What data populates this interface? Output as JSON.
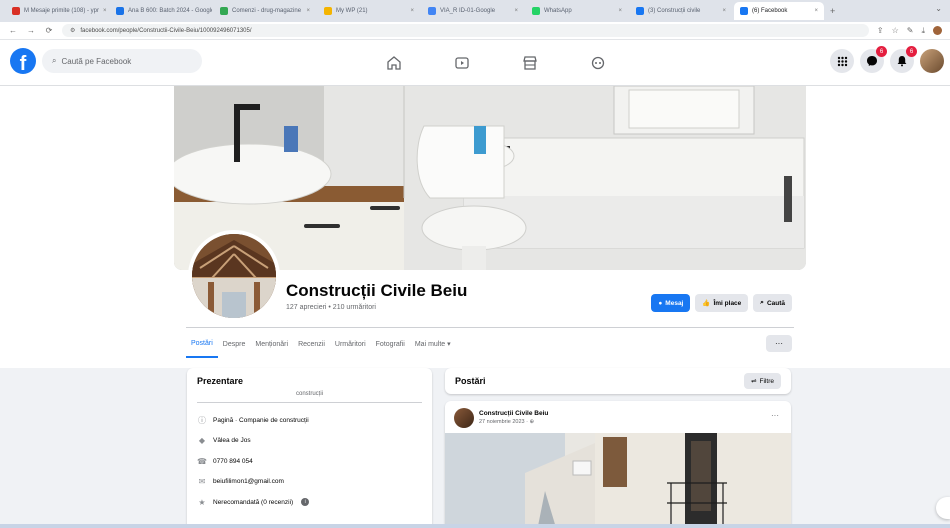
{
  "browser": {
    "tabs": [
      {
        "label": "M  Mesaje primite (108) - ypr",
        "color": "#d93025"
      },
      {
        "label": "Ana B 600: Batch 2024 - Google",
        "color": "#1a73e8"
      },
      {
        "label": "Comenzi - drug-magazine",
        "color": "#34a853"
      },
      {
        "label": "My WP (21)",
        "color": "#f4b400"
      },
      {
        "label": "VIA_R ID-01-Google",
        "color": "#4285f4"
      },
      {
        "label": "WhatsApp",
        "color": "#25d366"
      },
      {
        "label": "(3) Construcții civile",
        "color": "#1877f2"
      },
      {
        "label": "(6) Facebook",
        "color": "#1877f2"
      }
    ],
    "active_tab_index": 7,
    "new_tab": "+",
    "url": "facebook.com/people/Constructii-Civile-Beiu/100092496071305/"
  },
  "facebook": {
    "search_placeholder": "Caută pe Facebook",
    "nav_icons": [
      "home-icon",
      "video-icon",
      "marketplace-icon",
      "gaming-icon"
    ],
    "right_icons": [
      "menu-grid-icon",
      "messenger-icon",
      "notifications-icon",
      "account-avatar"
    ],
    "badges": {
      "messenger": "6",
      "notifications": "6"
    }
  },
  "page": {
    "name": "Construcții Civile Beiu",
    "stats": "127 aprecieri • 210 urmăritori",
    "buttons": {
      "message": "Mesaj",
      "like": "Îmi place",
      "search": "Caută"
    },
    "tabs": [
      "Postări",
      "Despre",
      "Menționări",
      "Recenzii",
      "Urmăritori",
      "Fotografii",
      "Mai multe ▾"
    ],
    "more_button": "···"
  },
  "intro": {
    "title": "Prezentare",
    "bio": "construcții",
    "rows": [
      {
        "icon": "info-icon",
        "text": "Pagină · Companie de construcții"
      },
      {
        "icon": "location-icon",
        "text": "Vâlea de Jos"
      },
      {
        "icon": "phone-icon",
        "text": "0770 894 054"
      },
      {
        "icon": "email-icon",
        "text": "beiufilimon1@gmail.com"
      },
      {
        "icon": "star-icon",
        "text": "Nerecomandată (0 recenzii)"
      }
    ]
  },
  "posts": {
    "title": "Postări",
    "filter_label": "Filtre",
    "first_post": {
      "author": "Construcții Civile Beiu",
      "date": "27 noiembrie 2023 · ",
      "more": "···"
    }
  }
}
